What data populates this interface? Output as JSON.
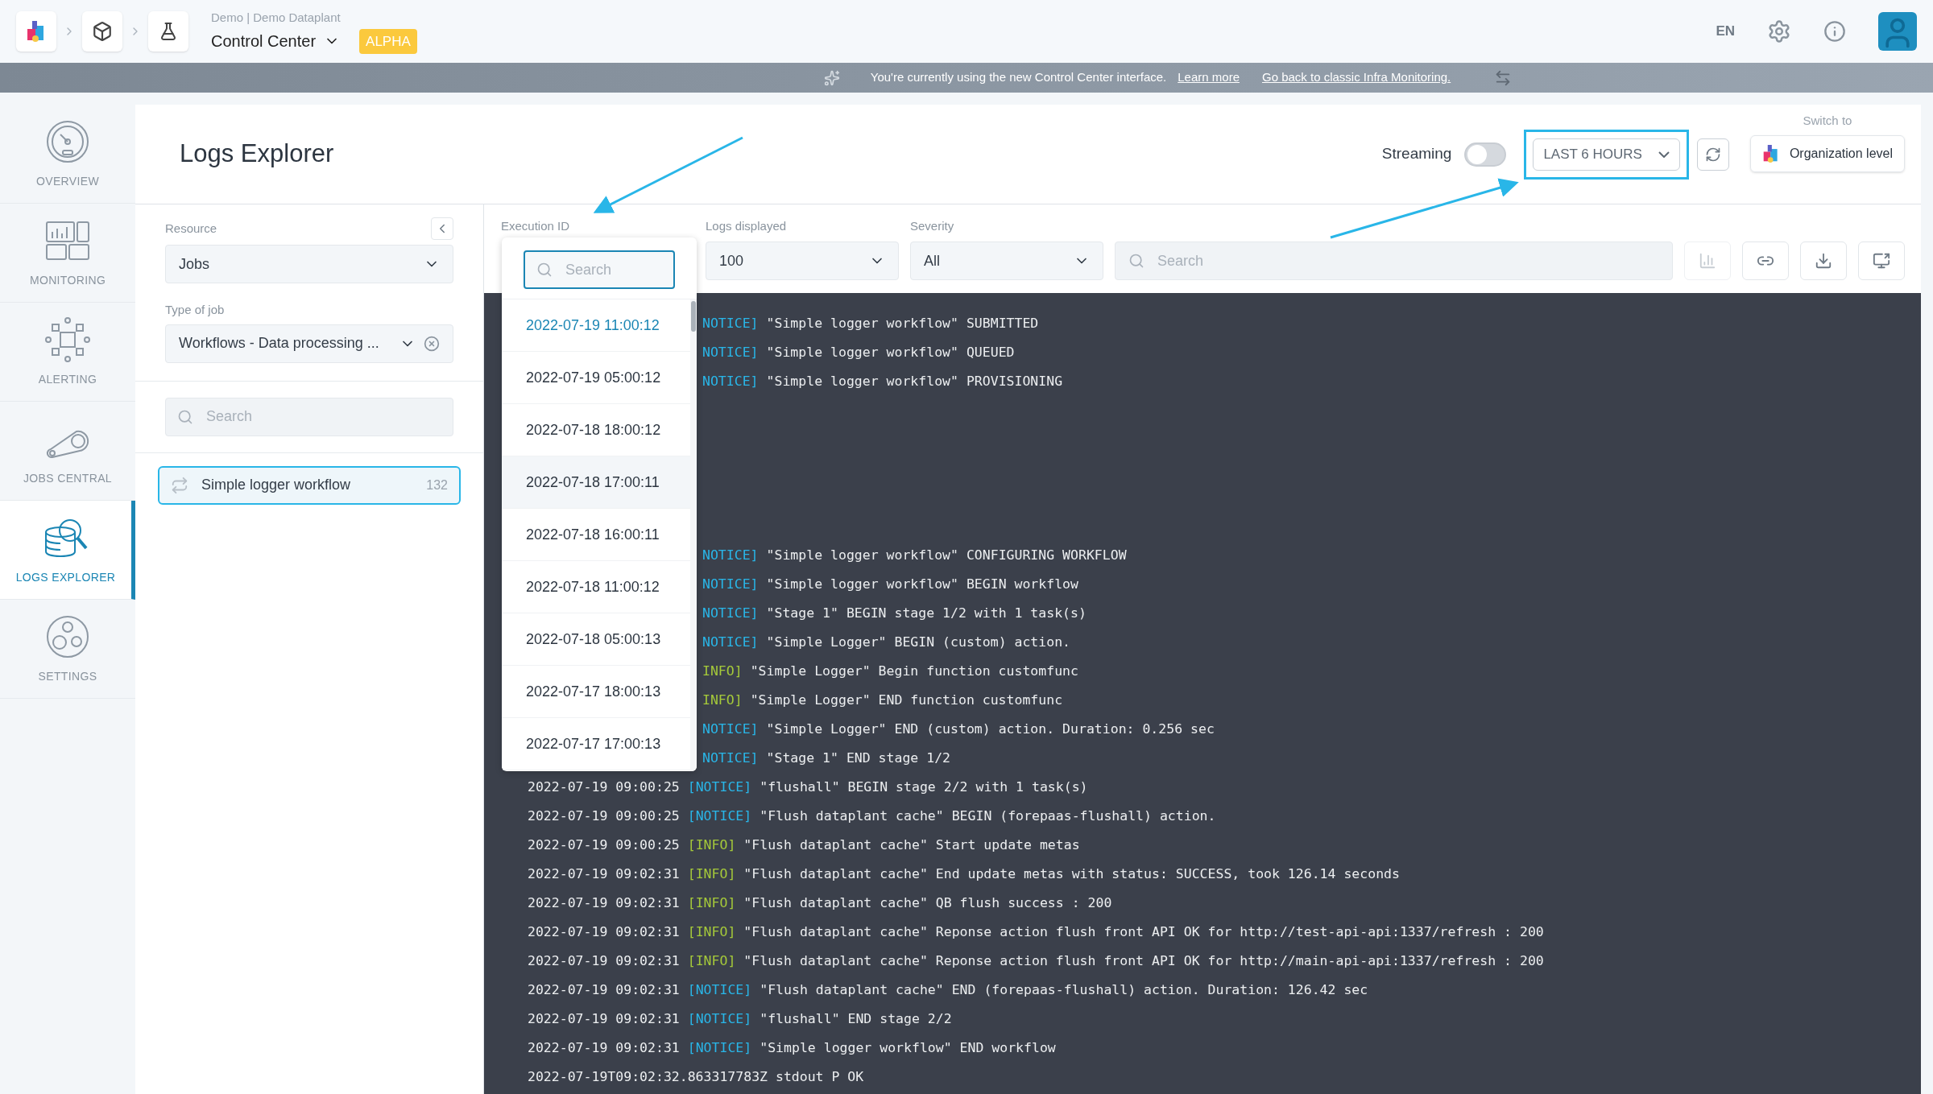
{
  "topbar": {
    "breadcrumb": "Demo | Demo Dataplant",
    "app": "Control Center",
    "badge": "ALPHA",
    "language": "EN"
  },
  "banner": {
    "message": "You're currently using the new Control Center interface.",
    "learn_more": "Learn more",
    "go_back": "Go back to classic Infra Monitoring."
  },
  "nav": [
    {
      "label": "OVERVIEW",
      "selected": false
    },
    {
      "label": "MONITORING",
      "selected": false
    },
    {
      "label": "ALERTING",
      "selected": false
    },
    {
      "label": "JOBS CENTRAL",
      "selected": false
    },
    {
      "label": "LOGS EXPLORER",
      "selected": true
    },
    {
      "label": "SETTINGS",
      "selected": false
    }
  ],
  "header": {
    "title": "Logs Explorer",
    "streaming_label": "Streaming",
    "streaming_on": false,
    "time_range": "LAST 6 HOURS",
    "switch_label": "Switch to",
    "switch_button": "Organization level"
  },
  "filters": {
    "resource_label": "Resource",
    "resource": "Jobs",
    "type_label": "Type of job",
    "type": "Workflows - Data processing ...",
    "search_placeholder": "Search",
    "jobs": [
      {
        "name": "Simple logger workflow",
        "count": "132",
        "selected": true
      }
    ]
  },
  "toolbar": {
    "execution_label": "Execution ID",
    "logs_label": "Logs displayed",
    "logs_value": "100",
    "severity_label": "Severity",
    "severity_value": "All",
    "search_placeholder": "Search"
  },
  "execution_dropdown": {
    "search_placeholder": "Search",
    "items": [
      {
        "label": "2022-07-19 11:00:12",
        "selected": true,
        "hovered": false
      },
      {
        "label": "2022-07-19 05:00:12",
        "selected": false,
        "hovered": false
      },
      {
        "label": "2022-07-18 18:00:12",
        "selected": false,
        "hovered": false
      },
      {
        "label": "2022-07-18 17:00:11",
        "selected": false,
        "hovered": true
      },
      {
        "label": "2022-07-18 16:00:11",
        "selected": false,
        "hovered": false
      },
      {
        "label": "2022-07-18 11:00:12",
        "selected": false,
        "hovered": false
      },
      {
        "label": "2022-07-18 05:00:13",
        "selected": false,
        "hovered": false
      },
      {
        "label": "2022-07-17 18:00:13",
        "selected": false,
        "hovered": false
      },
      {
        "label": "2022-07-17 17:00:13",
        "selected": false,
        "hovered": false
      }
    ]
  },
  "logs": [
    {
      "kind": "log",
      "level": "NOTICE]",
      "color": "#29b6e8",
      "message": "\"Simple logger workflow\" SUBMITTED"
    },
    {
      "kind": "log",
      "level": "NOTICE]",
      "color": "#29b6e8",
      "message": "\"Simple logger workflow\" QUEUED"
    },
    {
      "kind": "log",
      "level": "NOTICE]",
      "color": "#29b6e8",
      "message": "\"Simple logger workflow\" PROVISIONING"
    },
    {
      "kind": "gap"
    },
    {
      "kind": "gap"
    },
    {
      "kind": "gap"
    },
    {
      "kind": "gap"
    },
    {
      "kind": "gap"
    },
    {
      "kind": "log",
      "level": "NOTICE]",
      "color": "#29b6e8",
      "message": "\"Simple logger workflow\" CONFIGURING WORKFLOW"
    },
    {
      "kind": "log",
      "level": "NOTICE]",
      "color": "#29b6e8",
      "message": "\"Simple logger workflow\" BEGIN workflow"
    },
    {
      "kind": "log",
      "level": "NOTICE]",
      "color": "#29b6e8",
      "message": "\"Stage 1\" BEGIN stage 1/2 with 1 task(s)"
    },
    {
      "kind": "log",
      "level": "NOTICE]",
      "color": "#29b6e8",
      "message": "\"Simple Logger\" BEGIN (custom) action."
    },
    {
      "kind": "log",
      "level": "INFO]",
      "color": "#a5c93a",
      "message": "\"Simple Logger\" Begin function customfunc"
    },
    {
      "kind": "log",
      "level": "INFO]",
      "color": "#a5c93a",
      "message": "\"Simple Logger\" END function customfunc"
    },
    {
      "kind": "log",
      "level": "NOTICE]",
      "color": "#29b6e8",
      "message": "\"Simple Logger\" END (custom) action. Duration: 0.256 sec"
    },
    {
      "kind": "log",
      "level": "NOTICE]",
      "color": "#29b6e8",
      "message": "\"Stage 1\" END stage 1/2"
    },
    {
      "kind": "log",
      "time": "2022-07-19 09:00:25",
      "level": "[NOTICE]",
      "color": "#29b6e8",
      "message": "\"flushall\" BEGIN stage 2/2 with 1 task(s)"
    },
    {
      "kind": "log",
      "time": "2022-07-19 09:00:25",
      "level": "[NOTICE]",
      "color": "#29b6e8",
      "message": "\"Flush dataplant cache\" BEGIN (forepaas-flushall) action."
    },
    {
      "kind": "log",
      "time": "2022-07-19 09:00:25",
      "level": "[INFO]",
      "color": "#a5c93a",
      "message": "\"Flush dataplant cache\" Start update metas"
    },
    {
      "kind": "log",
      "time": "2022-07-19 09:02:31",
      "level": "[INFO]",
      "color": "#a5c93a",
      "message": "\"Flush dataplant cache\" End update metas with status: SUCCESS, took 126.14 seconds"
    },
    {
      "kind": "log",
      "time": "2022-07-19 09:02:31",
      "level": "[INFO]",
      "color": "#a5c93a",
      "message": "\"Flush dataplant cache\" QB flush success : 200"
    },
    {
      "kind": "log",
      "time": "2022-07-19 09:02:31",
      "level": "[INFO]",
      "color": "#a5c93a",
      "message": "\"Flush dataplant cache\" Reponse action flush front API OK for http://test-api-api:1337/refresh : 200"
    },
    {
      "kind": "log",
      "time": "2022-07-19 09:02:31",
      "level": "[INFO]",
      "color": "#a5c93a",
      "message": "\"Flush dataplant cache\" Reponse action flush front API OK for http://main-api-api:1337/refresh : 200"
    },
    {
      "kind": "log",
      "time": "2022-07-19 09:02:31",
      "level": "[NOTICE]",
      "color": "#29b6e8",
      "message": "\"Flush dataplant cache\" END (forepaas-flushall) action. Duration: 126.42 sec"
    },
    {
      "kind": "log",
      "time": "2022-07-19 09:02:31",
      "level": "[NOTICE]",
      "color": "#29b6e8",
      "message": "\"flushall\" END stage 2/2"
    },
    {
      "kind": "log",
      "time": "2022-07-19 09:02:31",
      "level": "[NOTICE]",
      "color": "#29b6e8",
      "message": "\"Simple logger workflow\" END workflow"
    },
    {
      "kind": "raw",
      "message": "2022-07-19T09:02:32.863317783Z stdout P OK"
    }
  ]
}
